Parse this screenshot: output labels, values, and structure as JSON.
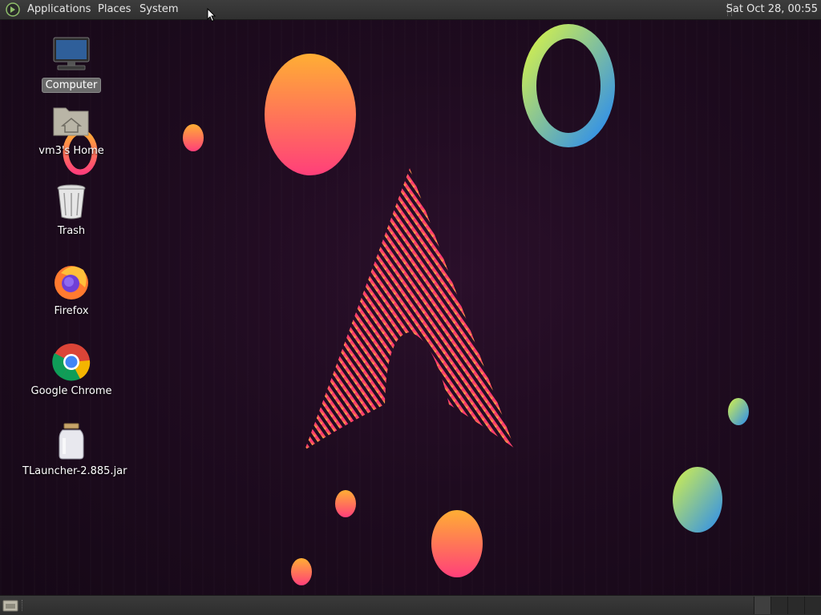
{
  "top_panel": {
    "menus": {
      "applications": "Applications",
      "places": "Places",
      "system": "System"
    },
    "clock": "Sat Oct 28, 00:55"
  },
  "desktop": {
    "icons": [
      {
        "label": "Computer",
        "icon": "computer-icon",
        "selected": true
      },
      {
        "label": "vm3's Home",
        "icon": "home-folder-icon"
      },
      {
        "label": "Trash",
        "icon": "trash-icon"
      },
      {
        "label": "Firefox",
        "icon": "firefox-icon"
      },
      {
        "label": "Google Chrome",
        "icon": "chrome-icon"
      },
      {
        "label": "TLauncher-2.885.jar",
        "icon": "jar-file-icon"
      }
    ]
  },
  "bottom_panel": {
    "workspaces": 4
  },
  "colors": {
    "panel": "#333333",
    "wallpaper": "#1e0b1f",
    "accent_pink": "#e8286e",
    "accent_orange": "#ff9a3c"
  }
}
